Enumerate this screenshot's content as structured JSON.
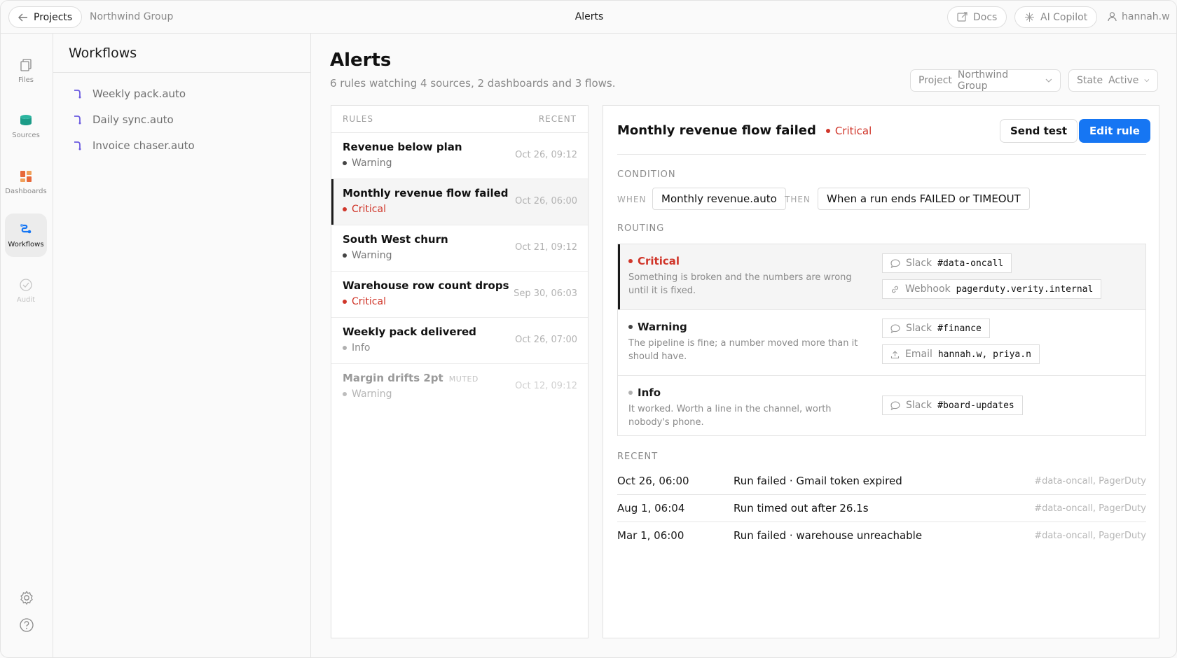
{
  "topbar": {
    "projects_label": "Projects",
    "breadcrumb": "Northwind Group",
    "title": "Alerts",
    "docs_label": "Docs",
    "copilot_label": "AI Copilot",
    "user": "hannah.w"
  },
  "rail": {
    "items": [
      {
        "label": "Files",
        "icon": "files-icon",
        "state": "normal"
      },
      {
        "label": "Sources",
        "icon": "database-icon",
        "state": "normal"
      },
      {
        "label": "Dashboards",
        "icon": "dashboard-icon",
        "state": "normal"
      },
      {
        "label": "Workflows",
        "icon": "workflow-icon",
        "state": "active"
      },
      {
        "label": "Audit",
        "icon": "check-circle-icon",
        "state": "disabled"
      }
    ],
    "bottom": [
      "gear-icon",
      "help-icon"
    ]
  },
  "workflows": {
    "title": "Workflows",
    "items": [
      "Weekly pack.auto",
      "Daily sync.auto",
      "Invoice chaser.auto"
    ]
  },
  "main": {
    "title": "Alerts",
    "subtitle": "6 rules watching 4 sources, 2 dashboards and 3 flows.",
    "filters": {
      "project_label": "Project",
      "project_value": "Northwind Group",
      "state_label": "State",
      "state_value": "Active"
    }
  },
  "rules": {
    "header_rules": "RULES",
    "header_recent": "RECENT",
    "items": [
      {
        "name": "Revenue below plan",
        "severity": "Warning",
        "time": "Oct 26, 09:12",
        "muted": false
      },
      {
        "name": "Monthly revenue flow failed",
        "severity": "Critical",
        "time": "Oct 26, 06:00",
        "muted": false
      },
      {
        "name": "South West churn",
        "severity": "Warning",
        "time": "Oct 21, 09:12",
        "muted": false
      },
      {
        "name": "Warehouse row count drops",
        "severity": "Critical",
        "time": "Sep 30, 06:03",
        "muted": false
      },
      {
        "name": "Weekly pack delivered",
        "severity": "Info",
        "time": "Oct 26, 07:00",
        "muted": false
      },
      {
        "name": "Margin drifts 2pt",
        "severity": "Warning",
        "time": "Oct 12, 09:12",
        "muted": true,
        "muted_tag": "MUTED"
      }
    ]
  },
  "detail": {
    "title": "Monthly revenue flow failed",
    "severity": "Critical",
    "send_test_label": "Send test",
    "edit_rule_label": "Edit rule",
    "condition_label": "CONDITION",
    "when_kw": "WHEN",
    "when_value": "Monthly revenue.auto",
    "then_kw": "THEN",
    "then_value": "When a run ends FAILED or TIMEOUT",
    "routing_label": "ROUTING",
    "routing": [
      {
        "name": "Critical",
        "desc": "Something is broken and the numbers are wrong until it is fixed.",
        "destinations": [
          {
            "type": "Slack",
            "target": "#data-oncall",
            "icon": "chat-icon"
          },
          {
            "type": "Webhook",
            "target": "pagerduty.verity.internal",
            "icon": "link-icon"
          }
        ]
      },
      {
        "name": "Warning",
        "desc": "The pipeline is fine; a number moved more than it should have.",
        "destinations": [
          {
            "type": "Slack",
            "target": "#finance",
            "icon": "chat-icon"
          },
          {
            "type": "Email",
            "target": "hannah.w, priya.n",
            "icon": "upload-icon"
          }
        ]
      },
      {
        "name": "Info",
        "desc": "It worked. Worth a line in the channel, worth nobody's phone.",
        "destinations": [
          {
            "type": "Slack",
            "target": "#board-updates",
            "icon": "chat-icon"
          }
        ]
      }
    ],
    "recent_label": "RECENT",
    "recent": [
      {
        "time": "Oct 26, 06:00",
        "message": "Run failed · Gmail token expired",
        "channels": "#data-oncall, PagerDuty"
      },
      {
        "time": "Aug 1, 06:04",
        "message": "Run timed out after 26.1s",
        "channels": "#data-oncall, PagerDuty"
      },
      {
        "time": "Mar 1, 06:00",
        "message": "Run failed · warehouse unreachable",
        "channels": "#data-oncall, PagerDuty"
      }
    ]
  },
  "colors": {
    "critical": "#d0362a",
    "warning": "#444444",
    "info": "#b0b0b0",
    "accent": "#1676f3",
    "workflow_icon": "#6b5be0"
  }
}
